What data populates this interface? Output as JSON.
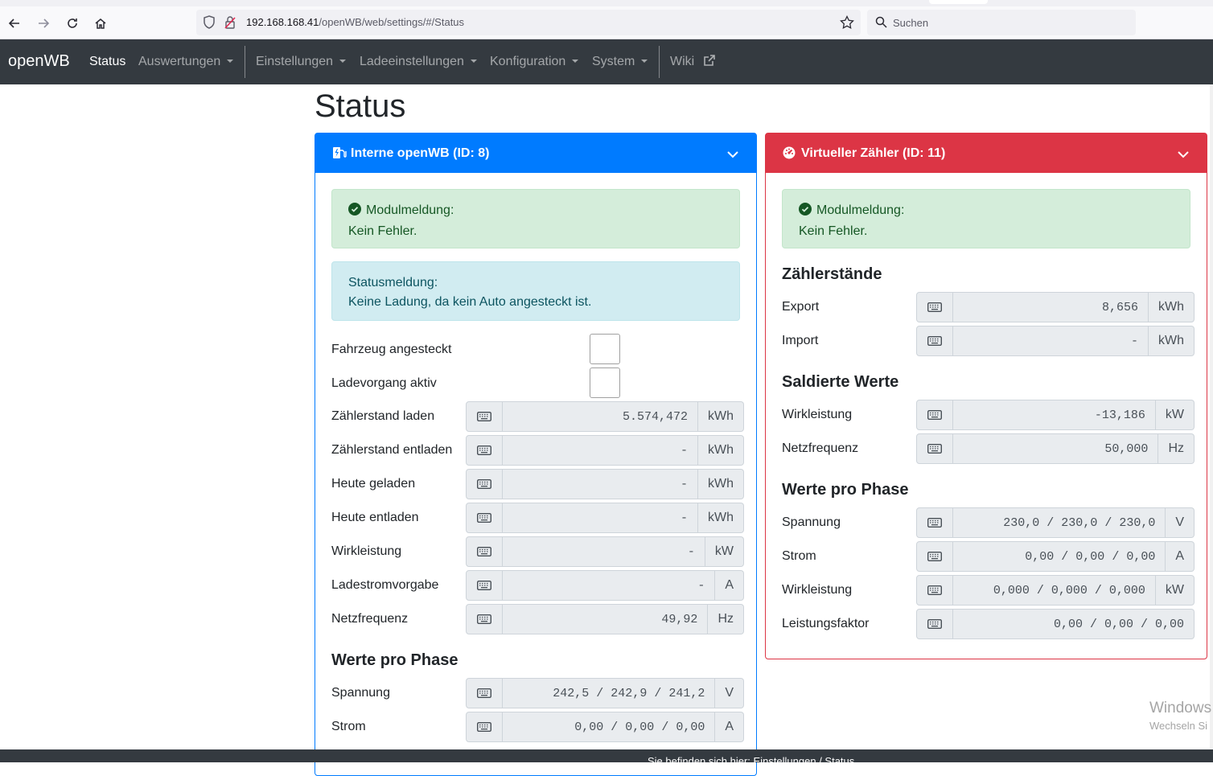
{
  "browser": {
    "url_host": "192.168.168.41",
    "url_path": "/openWB/web/settings/#/Status",
    "search_placeholder": "Suchen"
  },
  "navbar": {
    "brand": "openWB",
    "items": [
      {
        "label": "Status"
      },
      {
        "label": "Auswertungen"
      },
      {
        "label": "Einstellungen"
      },
      {
        "label": "Ladeeinstellungen"
      },
      {
        "label": "Konfiguration"
      },
      {
        "label": "System"
      },
      {
        "label": "Wiki"
      }
    ]
  },
  "page": {
    "title": "Status"
  },
  "card_a": {
    "title": "Interne openWB (ID: 8)",
    "color": "#007bff",
    "module_msg_label": "Modulmeldung:",
    "module_msg_text": "Kein Fehler.",
    "status_msg_label": "Statusmeldung:",
    "status_msg_text": "Keine Ladung, da kein Auto angesteckt ist.",
    "checks": [
      {
        "label": "Fahrzeug angesteckt"
      },
      {
        "label": "Ladevorgang aktiv"
      }
    ],
    "rows": [
      {
        "label": "Zählerstand laden",
        "value": "5.574,472",
        "unit": "kWh"
      },
      {
        "label": "Zählerstand entladen",
        "value": "-",
        "unit": "kWh"
      },
      {
        "label": "Heute geladen",
        "value": "-",
        "unit": "kWh"
      },
      {
        "label": "Heute entladen",
        "value": "-",
        "unit": "kWh"
      },
      {
        "label": "Wirkleistung",
        "value": "-",
        "unit": "kW"
      },
      {
        "label": "Ladestromvorgabe",
        "value": "-",
        "unit": "A"
      },
      {
        "label": "Netzfrequenz",
        "value": "49,92",
        "unit": "Hz"
      }
    ],
    "phase_heading": "Werte pro Phase",
    "phase_rows": [
      {
        "label": "Spannung",
        "value": "242,5 / 242,9 / 241,2",
        "unit": "V"
      },
      {
        "label": "Strom",
        "value": "0,00 / 0,00 / 0,00",
        "unit": "A"
      }
    ]
  },
  "card_b": {
    "title": "Virtueller Zähler (ID: 11)",
    "color": "#dc3545",
    "module_msg_label": "Modulmeldung:",
    "module_msg_text": "Kein Fehler.",
    "sec1": "Zählerstände",
    "sec1_rows": [
      {
        "label": "Export",
        "value": "8,656",
        "unit": "kWh"
      },
      {
        "label": "Import",
        "value": "-",
        "unit": "kWh"
      }
    ],
    "sec2": "Saldierte Werte",
    "sec2_rows": [
      {
        "label": "Wirkleistung",
        "value": "-13,186",
        "unit": "kW"
      },
      {
        "label": "Netzfrequenz",
        "value": "50,000",
        "unit": "Hz"
      }
    ],
    "sec3": "Werte pro Phase",
    "sec3_rows": [
      {
        "label": "Spannung",
        "value": "230,0 / 230,0 / 230,0",
        "unit": "V"
      },
      {
        "label": "Strom",
        "value": "0,00 / 0,00 / 0,00",
        "unit": "A"
      },
      {
        "label": "Wirkleistung",
        "value": "0,000 / 0,000 / 0,000",
        "unit": "kW"
      },
      {
        "label": "Leistungsfaktor",
        "value": "0,00 / 0,00 / 0,00",
        "unit": ""
      }
    ]
  },
  "footer": {
    "text": "Sie befinden sich hier: Einstellungen / Status"
  },
  "watermark": {
    "line1": "Windows",
    "line2": "Wechseln Si"
  }
}
